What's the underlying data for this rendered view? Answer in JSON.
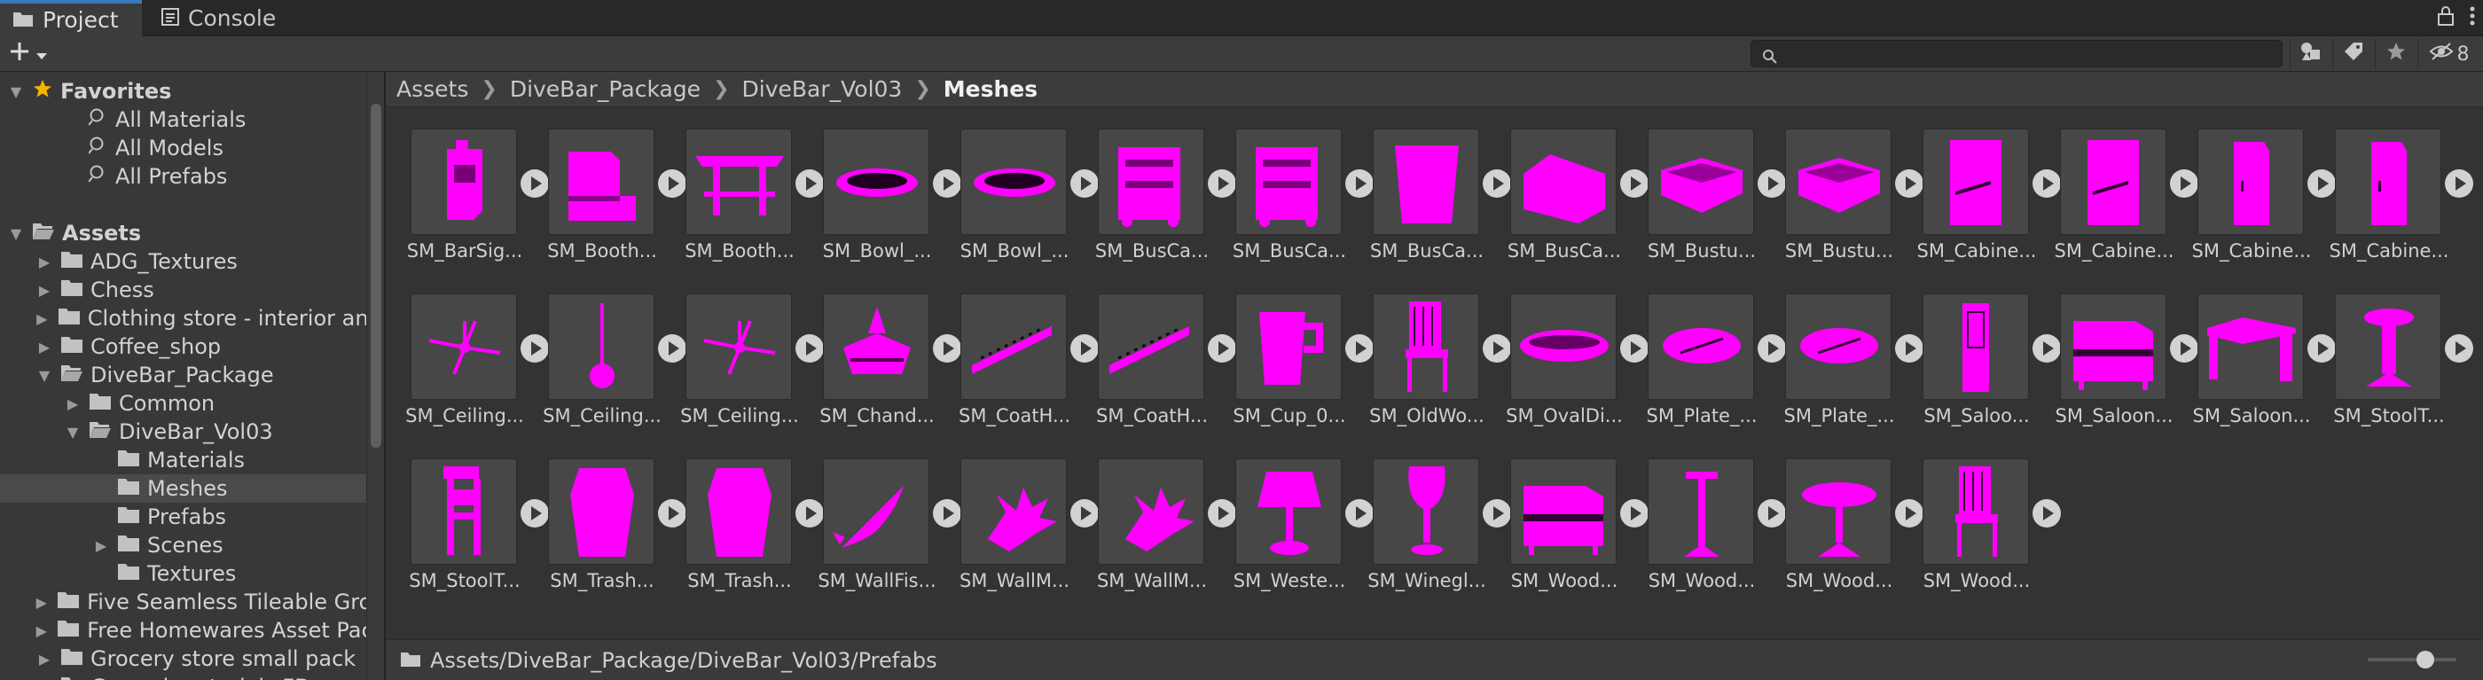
{
  "tabs": [
    {
      "label": "Project",
      "icon": "folder-icon",
      "active": true
    },
    {
      "label": "Console",
      "icon": "console-icon",
      "active": false
    }
  ],
  "tabbar": {
    "lock_icon": "lock-icon",
    "menu_icon": "kebab-menu-icon"
  },
  "toolbar": {
    "create_label": "+",
    "search": {
      "value": "",
      "placeholder": ""
    },
    "hidden_count": "8"
  },
  "tree": {
    "rows": [
      {
        "label": "Favorites",
        "indent": 0,
        "arrow": "down",
        "icon": "star",
        "bold": true
      },
      {
        "label": "All Materials",
        "indent": 2,
        "arrow": "",
        "icon": "search"
      },
      {
        "label": "All Models",
        "indent": 2,
        "arrow": "",
        "icon": "search"
      },
      {
        "label": "All Prefabs",
        "indent": 2,
        "arrow": "",
        "icon": "search"
      },
      {
        "label": "",
        "indent": 0,
        "arrow": "",
        "icon": "none"
      },
      {
        "label": "Assets",
        "indent": 0,
        "arrow": "down",
        "icon": "folder-open",
        "bold": true
      },
      {
        "label": "ADG_Textures",
        "indent": 1,
        "arrow": "right",
        "icon": "folder"
      },
      {
        "label": "Chess",
        "indent": 1,
        "arrow": "right",
        "icon": "folder"
      },
      {
        "label": "Clothing store - interior and",
        "indent": 1,
        "arrow": "right",
        "icon": "folder"
      },
      {
        "label": "Coffee_shop",
        "indent": 1,
        "arrow": "right",
        "icon": "folder"
      },
      {
        "label": "DiveBar_Package",
        "indent": 1,
        "arrow": "down",
        "icon": "folder-open"
      },
      {
        "label": "Common",
        "indent": 2,
        "arrow": "right",
        "icon": "folder"
      },
      {
        "label": "DiveBar_Vol03",
        "indent": 2,
        "arrow": "down",
        "icon": "folder-open"
      },
      {
        "label": "Materials",
        "indent": 3,
        "arrow": "",
        "icon": "folder"
      },
      {
        "label": "Meshes",
        "indent": 3,
        "arrow": "",
        "icon": "folder",
        "selected": true
      },
      {
        "label": "Prefabs",
        "indent": 3,
        "arrow": "",
        "icon": "folder"
      },
      {
        "label": "Scenes",
        "indent": 3,
        "arrow": "right",
        "icon": "folder"
      },
      {
        "label": "Textures",
        "indent": 3,
        "arrow": "",
        "icon": "folder"
      },
      {
        "label": "Five Seamless Tileable Grou",
        "indent": 1,
        "arrow": "right",
        "icon": "folder"
      },
      {
        "label": "Free Homewares Asset Pack",
        "indent": 1,
        "arrow": "right",
        "icon": "folder"
      },
      {
        "label": "Grocery store small pack",
        "indent": 1,
        "arrow": "right",
        "icon": "folder"
      },
      {
        "label": "Ground materials FD",
        "indent": 1,
        "arrow": "right",
        "icon": "folder"
      }
    ]
  },
  "breadcrumb": [
    "Assets",
    "DiveBar_Package",
    "DiveBar_Vol03",
    "Meshes"
  ],
  "assets": [
    {
      "label": "SM_BarSig...",
      "shape": "sign"
    },
    {
      "label": "SM_Booth...",
      "shape": "booth"
    },
    {
      "label": "SM_Booth...",
      "shape": "table"
    },
    {
      "label": "SM_Bowl_...",
      "shape": "bowl"
    },
    {
      "label": "SM_Bowl_...",
      "shape": "bowl"
    },
    {
      "label": "SM_BusCa...",
      "shape": "cart"
    },
    {
      "label": "SM_BusCa...",
      "shape": "cart"
    },
    {
      "label": "SM_BusCa...",
      "shape": "bin"
    },
    {
      "label": "SM_BusCa...",
      "shape": "tray"
    },
    {
      "label": "SM_Bustu...",
      "shape": "tub"
    },
    {
      "label": "SM_Bustu...",
      "shape": "tub"
    },
    {
      "label": "SM_Cabine...",
      "shape": "cabinet"
    },
    {
      "label": "SM_Cabine...",
      "shape": "cabinet"
    },
    {
      "label": "SM_Cabine...",
      "shape": "panel"
    },
    {
      "label": "SM_Cabine...",
      "shape": "panel"
    },
    {
      "label": "SM_Ceiling...",
      "shape": "fan"
    },
    {
      "label": "SM_Ceiling...",
      "shape": "lamp"
    },
    {
      "label": "SM_Ceiling...",
      "shape": "fan"
    },
    {
      "label": "SM_Chand...",
      "shape": "chandelier"
    },
    {
      "label": "SM_CoatH...",
      "shape": "rack"
    },
    {
      "label": "SM_CoatH...",
      "shape": "rack"
    },
    {
      "label": "SM_Cup_0...",
      "shape": "cup"
    },
    {
      "label": "SM_OldWo...",
      "shape": "chair"
    },
    {
      "label": "SM_OvalDi...",
      "shape": "dish"
    },
    {
      "label": "SM_Plate_...",
      "shape": "plate"
    },
    {
      "label": "SM_Plate_...",
      "shape": "plate"
    },
    {
      "label": "SM_Saloo...",
      "shape": "door"
    },
    {
      "label": "SM_Saloon...",
      "shape": "piano"
    },
    {
      "label": "SM_Saloon...",
      "shape": "desk"
    },
    {
      "label": "SM_StoolT...",
      "shape": "stool"
    },
    {
      "label": "SM_StoolT...",
      "shape": "stooltall"
    },
    {
      "label": "SM_Trash...",
      "shape": "trash"
    },
    {
      "label": "SM_Trash...",
      "shape": "trash"
    },
    {
      "label": "SM_WallFis...",
      "shape": "fish"
    },
    {
      "label": "SM_WallM...",
      "shape": "antler"
    },
    {
      "label": "SM_WallM...",
      "shape": "antler"
    },
    {
      "label": "SM_Weste...",
      "shape": "tablelamp"
    },
    {
      "label": "SM_Winegl...",
      "shape": "wineglass"
    },
    {
      "label": "SM_Wood...",
      "shape": "piano"
    },
    {
      "label": "SM_Wood...",
      "shape": "coatstand"
    },
    {
      "label": "SM_Wood...",
      "shape": "roundtable"
    },
    {
      "label": "SM_Wood...",
      "shape": "chair"
    }
  ],
  "pathbar": {
    "path": "Assets/DiveBar_Package/DiveBar_Vol03/Prefabs"
  },
  "colors": {
    "accent": "#3a79bb",
    "mesh": "#ff00ff",
    "star": "#f4b400"
  }
}
